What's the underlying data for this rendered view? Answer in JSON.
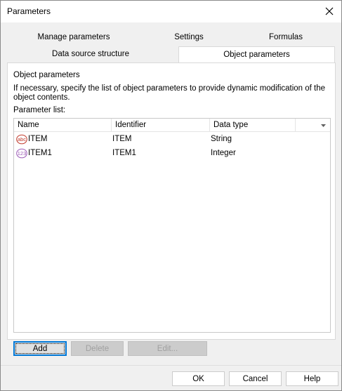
{
  "window": {
    "title": "Parameters"
  },
  "tabs": {
    "row1": [
      {
        "label": "Manage parameters"
      },
      {
        "label": "Settings"
      },
      {
        "label": "Formulas"
      }
    ],
    "row2": [
      {
        "label": "Data source structure"
      },
      {
        "label": "Object parameters",
        "active": true
      }
    ]
  },
  "panel": {
    "group_title": "Object parameters",
    "description": "If necessary, specify the list of object parameters to provide dynamic modification of the object contents.",
    "list_label": "Parameter list:",
    "columns": [
      "Name",
      "Identifier",
      "Data type"
    ],
    "rows": [
      {
        "icon": "string-type-icon",
        "icon_text": "abc",
        "name": "ITEM",
        "identifier": "ITEM",
        "data_type": "String"
      },
      {
        "icon": "integer-type-icon",
        "icon_text": "123",
        "name": "ITEM1",
        "identifier": "ITEM1",
        "data_type": "Integer"
      }
    ],
    "buttons": {
      "add": "Add",
      "delete": "Delete",
      "edit": "Edit..."
    }
  },
  "footer": {
    "ok": "OK",
    "cancel": "Cancel",
    "help": "Help"
  },
  "colors": {
    "accent": "#0078d7",
    "icon_red": "#c0392b",
    "icon_purple": "#9b59b6"
  }
}
